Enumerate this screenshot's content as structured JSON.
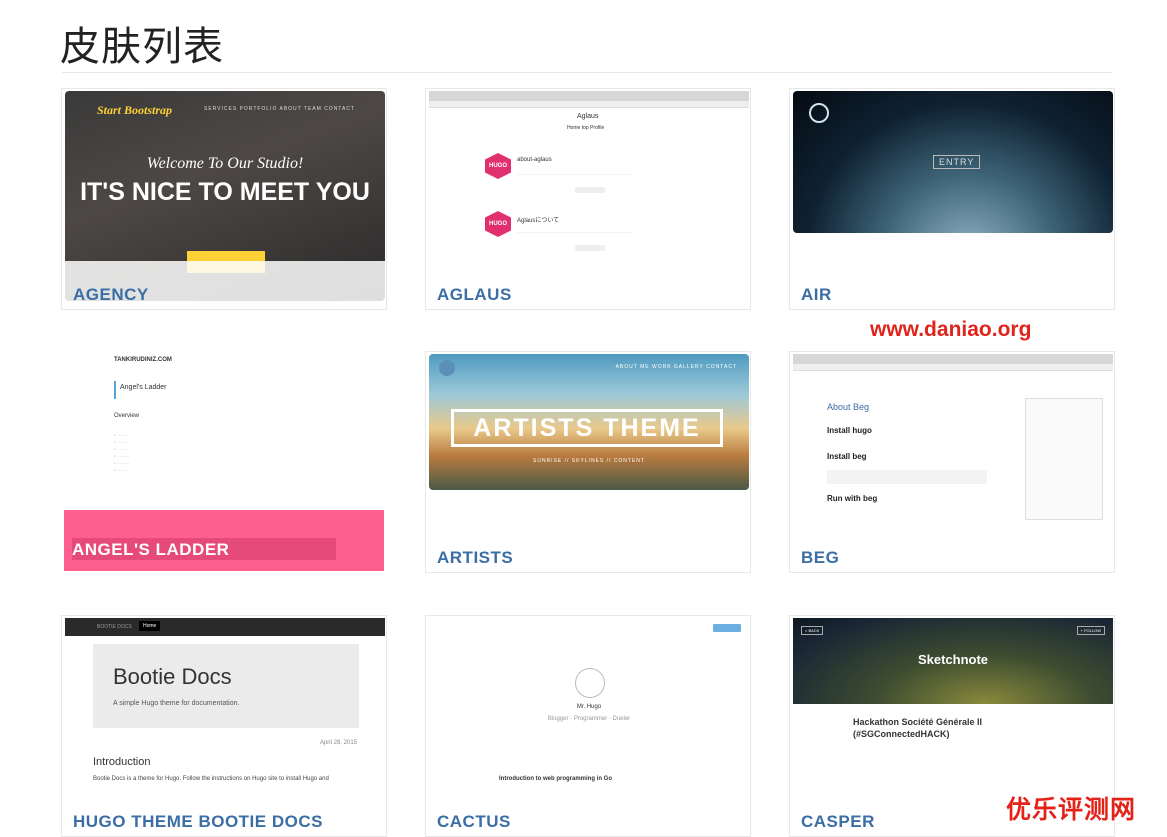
{
  "page": {
    "title": "皮肤列表"
  },
  "themes": [
    {
      "label": "AGENCY",
      "preview": {
        "brand": "Start Bootstrap",
        "nav": "SERVICES   PORTFOLIO   ABOUT   TEAM   CONTACT",
        "welcome": "Welcome To Our Studio!",
        "headline": "IT'S NICE TO MEET YOU"
      }
    },
    {
      "label": "AGLAUS",
      "preview": {
        "site": "Aglaus",
        "nav": "Home top   Profile",
        "post1_title": "about-aglaus",
        "post2_title": "Aglausについて",
        "hugo": "HUGO"
      }
    },
    {
      "label": "AIR",
      "preview": {
        "button": "ENTRY"
      }
    },
    {
      "label": "ANGEL'S LADDER",
      "preview": {
        "site": "TANKIRUDINIZ.COM",
        "post_title": "Angel's Ladder",
        "section": "Overview"
      }
    },
    {
      "label": "ARTISTS",
      "preview": {
        "headline": "ARTISTS THEME",
        "nav": "ABOUT ME   WORK   GALLERY   CONTACT",
        "sub": "SUNRISE // SKYLINES // CONTENT"
      }
    },
    {
      "label": "BEG",
      "preview": {
        "h1": "About Beg",
        "h2": "Install hugo",
        "h3": "Install beg",
        "h4": "Run with beg"
      }
    },
    {
      "label": "HUGO THEME BOOTIE DOCS",
      "preview": {
        "brand": "BOOTIE DOCS",
        "tab": "Home",
        "jumbo_title": "Bootie Docs",
        "jumbo_sub": "A simple Hugo theme for documentation.",
        "date": "April 28, 2015",
        "section": "Introduction",
        "body": "Bootie Docs is a theme for Hugo. Follow the instructions on Hugo site to install Hugo and"
      }
    },
    {
      "label": "CACTUS",
      "preview": {
        "name": "Mr. Hugo",
        "tagline": "Blogger · Programmer · Dueler",
        "post": "Introduction to web programming in Go"
      }
    },
    {
      "label": "CASPER",
      "preview": {
        "title": "Sketchnote",
        "post": "Hackathon Société Générale II (#SGConnectedHACK)",
        "back": "< BACK",
        "follow": "+ FOLLOW"
      }
    }
  ],
  "watermarks": {
    "site": "www.daniao.org",
    "brand": "优乐评测网"
  },
  "colors": {
    "label": "#3a6ea5",
    "accent_pink": "#ff5f8f",
    "agency_yellow": "#fed136"
  }
}
